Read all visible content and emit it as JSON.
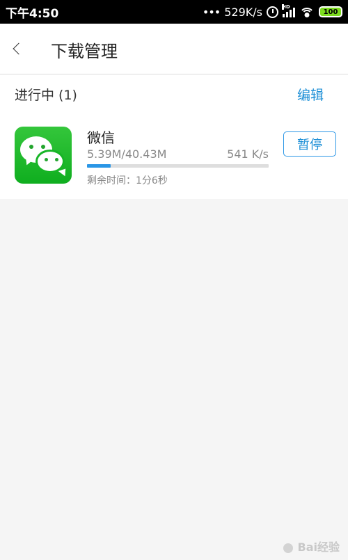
{
  "status_bar": {
    "time": "下午4:50",
    "network_speed": "529K/s",
    "network_label": "HD",
    "battery": "100",
    "signal_icon": "signal-bars-icon",
    "wifi_icon": "wifi-icon",
    "alarm_icon": "alarm-icon",
    "battery_color": "#7ddc1f"
  },
  "header": {
    "title": "下载管理",
    "back_icon": "back-chevron-icon"
  },
  "section": {
    "label": "进行中 (1)",
    "edit_label": "编辑"
  },
  "download_item": {
    "name": "微信",
    "progress_text": "5.39M/40.43M",
    "speed": "541 K/s",
    "remaining": "剩余时间：1分6秒",
    "progress_fraction": 0.13,
    "pause_label": "暂停",
    "icon": "wechat-icon",
    "accent_color": "#2a96e6"
  },
  "watermark": {
    "text": "Bai经验"
  }
}
